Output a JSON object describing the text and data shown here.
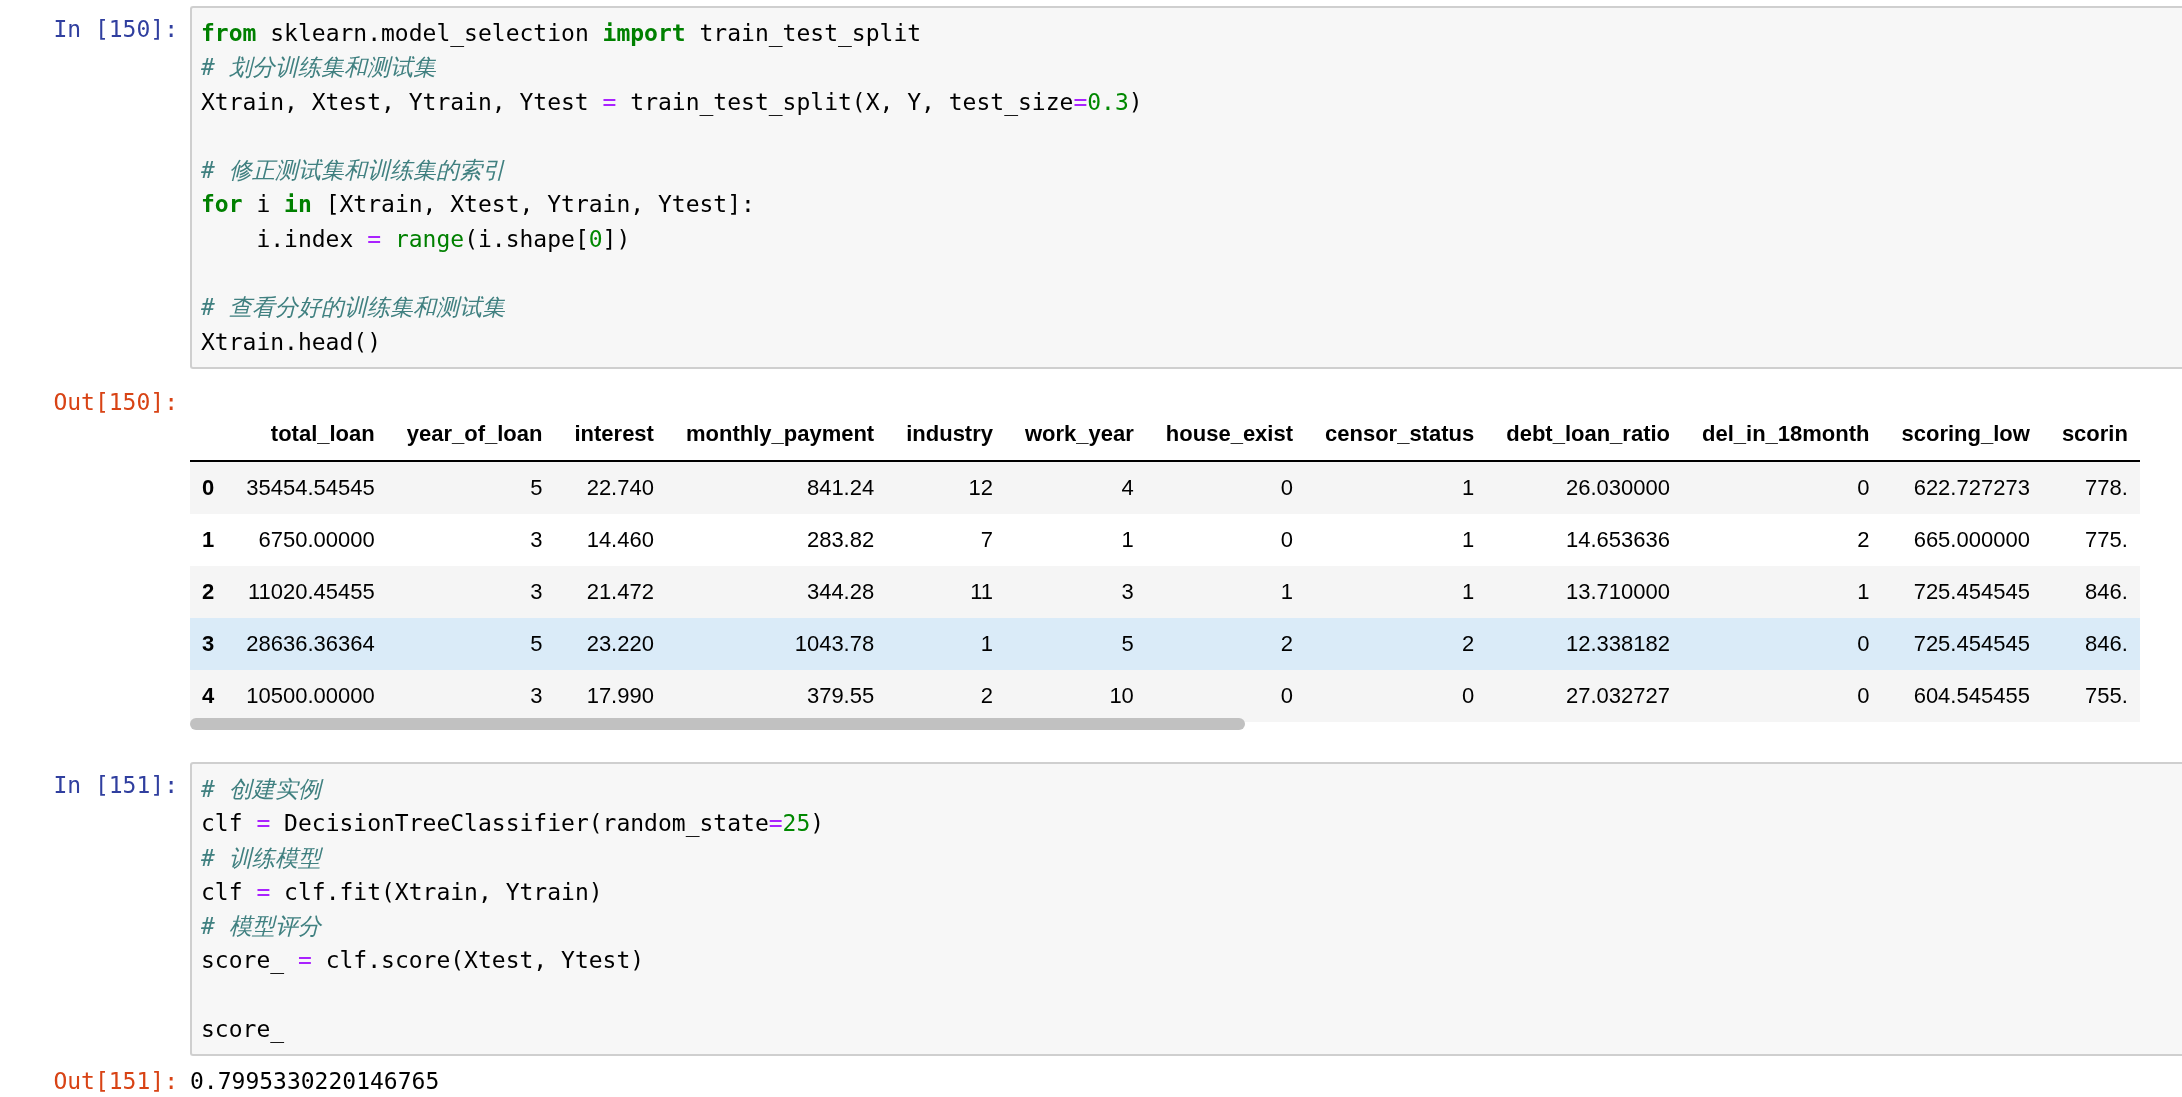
{
  "cells": [
    {
      "kind": "code",
      "prompt": "In [150]:",
      "blocks": [
        [
          [
            {
              "kind": "kw",
              "text": "from"
            },
            {
              "kind": "plain",
              "text": " sklearn.model_selection "
            },
            {
              "kind": "kw",
              "text": "import"
            },
            {
              "kind": "plain",
              "text": " train_test_split"
            }
          ],
          [
            {
              "kind": "comment",
              "text": "# 划分训练集和测试集"
            }
          ],
          [
            {
              "kind": "plain",
              "text": "Xtrain, Xtest, Ytrain, Ytest "
            },
            {
              "kind": "op",
              "text": "="
            },
            {
              "kind": "plain",
              "text": " train_test_split(X, Y, test_size"
            },
            {
              "kind": "op",
              "text": "="
            },
            {
              "kind": "num",
              "text": "0.3"
            },
            {
              "kind": "plain",
              "text": ")"
            }
          ]
        ],
        [
          [
            {
              "kind": "comment",
              "text": "# 修正测试集和训练集的索引"
            }
          ],
          [
            {
              "kind": "kw",
              "text": "for"
            },
            {
              "kind": "plain",
              "text": " i "
            },
            {
              "kind": "kw",
              "text": "in"
            },
            {
              "kind": "plain",
              "text": " [Xtrain, Xtest, Ytrain, Ytest]:"
            }
          ],
          [
            {
              "kind": "plain",
              "text": "    i.index "
            },
            {
              "kind": "op",
              "text": "="
            },
            {
              "kind": "builtin",
              "text": " range"
            },
            {
              "kind": "plain",
              "text": "(i.shape["
            },
            {
              "kind": "num",
              "text": "0"
            },
            {
              "kind": "plain",
              "text": "])"
            }
          ]
        ],
        [
          [
            {
              "kind": "comment",
              "text": "# 查看分好的训练集和测试集"
            }
          ],
          [
            {
              "kind": "plain",
              "text": "Xtrain.head()"
            }
          ]
        ]
      ],
      "output": {
        "kind": "table",
        "prompt": "Out[150]:",
        "columns": [
          "total_loan",
          "year_of_loan",
          "interest",
          "monthly_payment",
          "industry",
          "work_year",
          "house_exist",
          "censor_status",
          "debt_loan_ratio",
          "del_in_18month",
          "scoring_low",
          "scorin"
        ],
        "rows": [
          {
            "highlighted": false,
            "index": "0",
            "cells": [
              "35454.54545",
              "5",
              "22.740",
              "841.24",
              "12",
              "4",
              "0",
              "1",
              "26.030000",
              "0",
              "622.727273",
              "778."
            ]
          },
          {
            "highlighted": false,
            "index": "1",
            "cells": [
              "6750.00000",
              "3",
              "14.460",
              "283.82",
              "7",
              "1",
              "0",
              "1",
              "14.653636",
              "2",
              "665.000000",
              "775."
            ]
          },
          {
            "highlighted": false,
            "index": "2",
            "cells": [
              "11020.45455",
              "3",
              "21.472",
              "344.28",
              "11",
              "3",
              "1",
              "1",
              "13.710000",
              "1",
              "725.454545",
              "846."
            ]
          },
          {
            "highlighted": true,
            "index": "3",
            "cells": [
              "28636.36364",
              "5",
              "23.220",
              "1043.78",
              "1",
              "5",
              "2",
              "2",
              "12.338182",
              "0",
              "725.454545",
              "846."
            ]
          },
          {
            "highlighted": false,
            "index": "4",
            "cells": [
              "10500.00000",
              "3",
              "17.990",
              "379.55",
              "2",
              "10",
              "0",
              "0",
              "27.032727",
              "0",
              "604.545455",
              "755."
            ]
          }
        ]
      }
    },
    {
      "kind": "code",
      "prompt": "In [151]:",
      "blocks": [
        [
          [
            {
              "kind": "comment",
              "text": "# 创建实例"
            }
          ],
          [
            {
              "kind": "plain",
              "text": "clf "
            },
            {
              "kind": "op",
              "text": "="
            },
            {
              "kind": "plain",
              "text": " DecisionTreeClassifier(random_state"
            },
            {
              "kind": "op",
              "text": "="
            },
            {
              "kind": "num",
              "text": "25"
            },
            {
              "kind": "plain",
              "text": ")"
            }
          ],
          [
            {
              "kind": "comment",
              "text": "# 训练模型"
            }
          ],
          [
            {
              "kind": "plain",
              "text": "clf "
            },
            {
              "kind": "op",
              "text": "="
            },
            {
              "kind": "plain",
              "text": " clf.fit(Xtrain, Ytrain)"
            }
          ],
          [
            {
              "kind": "comment",
              "text": "# 模型评分"
            }
          ],
          [
            {
              "kind": "plain",
              "text": "score_ "
            },
            {
              "kind": "op",
              "text": "="
            },
            {
              "kind": "plain",
              "text": " clf.score(Xtest, Ytest)"
            }
          ]
        ],
        [
          [
            {
              "kind": "plain",
              "text": "score_"
            }
          ]
        ]
      ],
      "output": {
        "kind": "text",
        "prompt": "Out[151]:",
        "text": "0.7995330220146765"
      }
    }
  ]
}
